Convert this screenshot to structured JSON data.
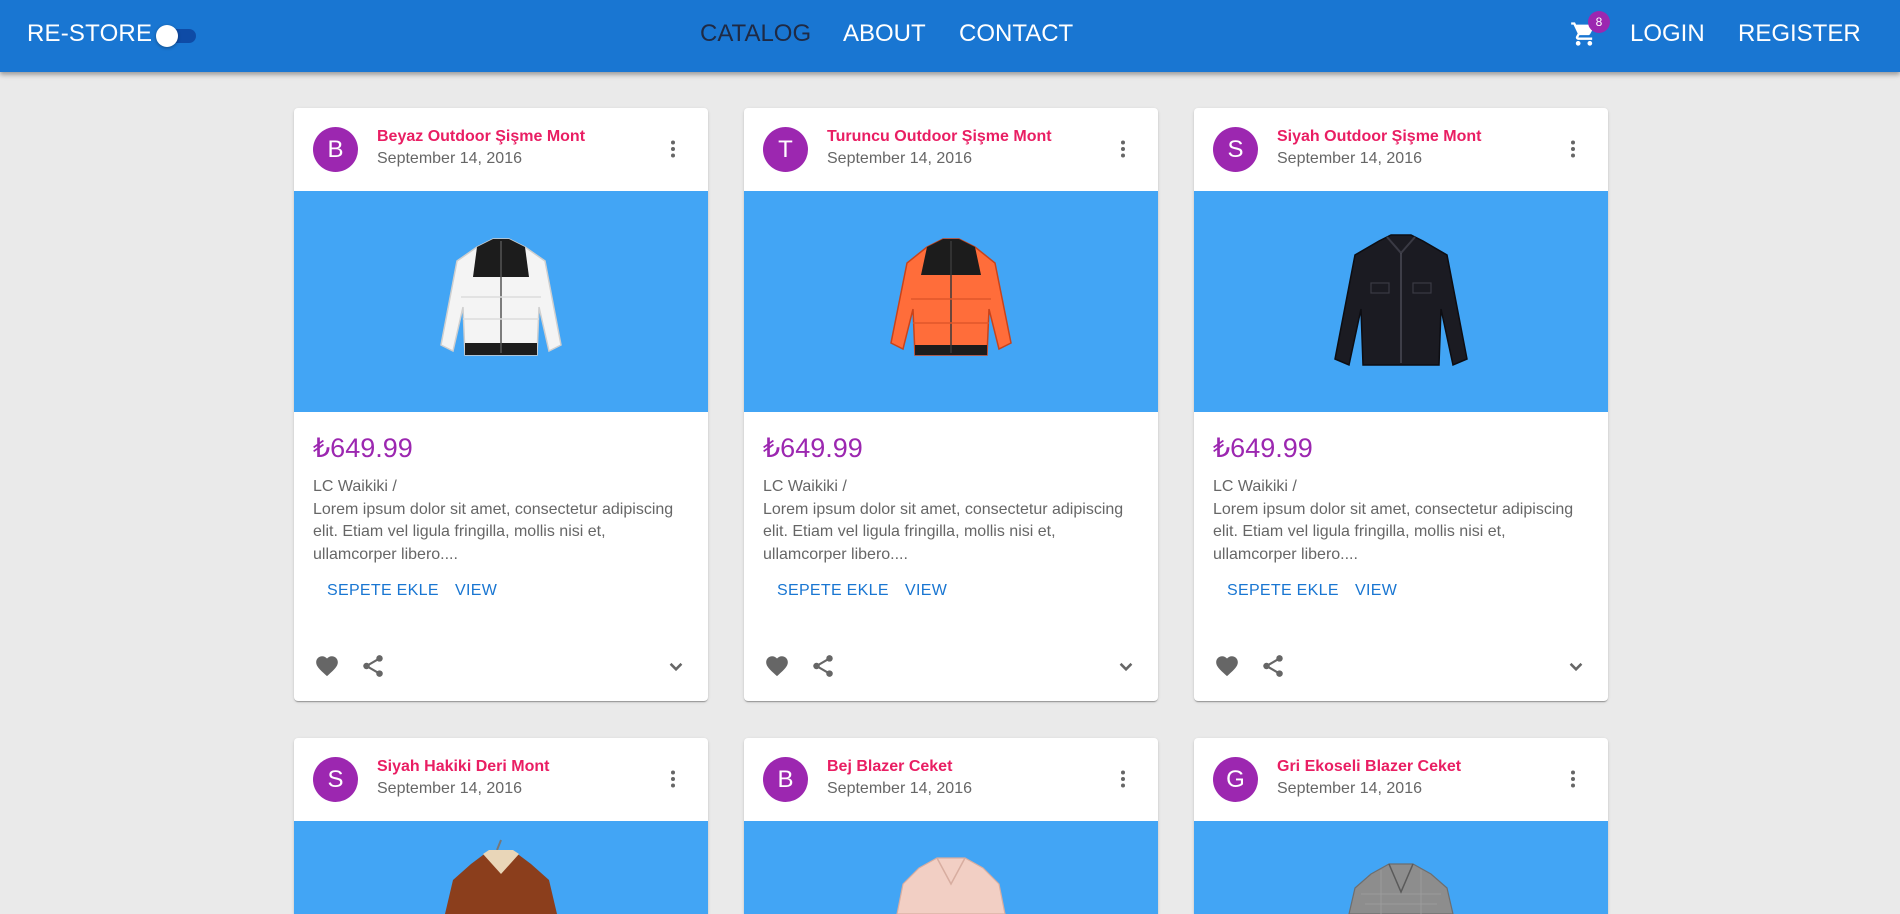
{
  "header": {
    "brand": "RE-STORE",
    "nav": [
      "CATALOG",
      "ABOUT",
      "CONTACT"
    ],
    "cart_count": "8",
    "login": "LOGIN",
    "register": "REGISTER",
    "dark_mode_on": false
  },
  "products": [
    {
      "initial": "B",
      "name": "Beyaz Outdoor Şişme Mont",
      "date": "September 14, 2016",
      "price": "₺649.99",
      "brand_line": "LC Waikiki /",
      "description": "Lorem ipsum dolor sit amet, consectetur adipiscing elit. Etiam vel ligula fringilla, mollis nisi et, ullamcorper libero....",
      "add_label": "SEPETE EKLE",
      "view_label": "VIEW"
    },
    {
      "initial": "T",
      "name": "Turuncu Outdoor Şişme Mont",
      "date": "September 14, 2016",
      "price": "₺649.99",
      "brand_line": "LC Waikiki /",
      "description": "Lorem ipsum dolor sit amet, consectetur adipiscing elit. Etiam vel ligula fringilla, mollis nisi et, ullamcorper libero....",
      "add_label": "SEPETE EKLE",
      "view_label": "VIEW"
    },
    {
      "initial": "S",
      "name": "Siyah Outdoor Şişme Mont",
      "date": "September 14, 2016",
      "price": "₺649.99",
      "brand_line": "LC Waikiki /",
      "description": "Lorem ipsum dolor sit amet, consectetur adipiscing elit. Etiam vel ligula fringilla, mollis nisi et, ullamcorper libero....",
      "add_label": "SEPETE EKLE",
      "view_label": "VIEW"
    },
    {
      "initial": "S",
      "name": "Siyah Hakiki Deri Mont",
      "date": "September 14, 2016"
    },
    {
      "initial": "B",
      "name": "Bej Blazer Ceket",
      "date": "September 14, 2016"
    },
    {
      "initial": "G",
      "name": "Gri Ekoseli Blazer Ceket",
      "date": "September 14, 2016"
    }
  ],
  "colors": {
    "appbar": "#1976d2",
    "accent_purple": "#9c27b0",
    "title_pink": "#e91e63",
    "media_blue": "#42a5f5",
    "link_blue": "#1976d2"
  },
  "icons": [
    "cart-icon",
    "more-vert-icon",
    "favorite-icon",
    "share-icon",
    "expand-more-icon"
  ]
}
